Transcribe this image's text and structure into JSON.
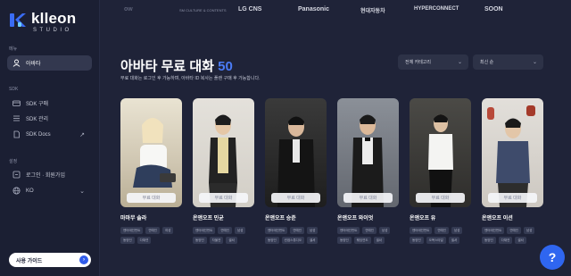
{
  "brand": {
    "name": "klleon",
    "sub": "STUDIO"
  },
  "sidebar": {
    "section_main": "메뉴",
    "section_sdk": "SDK",
    "section_settings": "설정",
    "items": [
      {
        "label": "아바타",
        "icon": "avatar-icon"
      },
      {
        "label": "SDK 구매",
        "icon": "card-icon"
      },
      {
        "label": "SDK 관리",
        "icon": "manage-icon"
      },
      {
        "label": "SDK Docs",
        "icon": "docs-icon",
        "right": "↗"
      },
      {
        "label": "로그인 · 회원가입",
        "icon": "login-icon",
        "right": "•"
      },
      {
        "label": "KO",
        "icon": "globe-icon",
        "right": "⌄"
      }
    ],
    "guide_label": "사용 가이드",
    "guide_arrow": "›"
  },
  "partners": [
    "ow",
    "SM CULTURE & CONTENTS",
    "LG CNS",
    "Panasonic",
    "현대자동차",
    "HYPERCONNECT",
    "SOON"
  ],
  "main": {
    "title": "아바타 무료 대화",
    "count": "50",
    "subtitle": "무료 대화는 로그인 후 가능하며, 아바타 ID 복사는 플랜 구매 후 가능합니다.",
    "filter_category": "전체 카테고리",
    "filter_sort": "최신 순"
  },
  "card_button_label": "무료 대화",
  "cards": [
    {
      "name": "마마무 솔라",
      "tags": [
        "엔터테인먼트",
        "연예인",
        "여성",
        "동양인",
        "다채연"
      ],
      "bg": "#cfc6b1"
    },
    {
      "name": "온앤오프 민균",
      "tags": [
        "엔터테인먼트",
        "연예인",
        "남성",
        "동양인",
        "자율연",
        "셀셔"
      ],
      "bg": "#d8d4cc"
    },
    {
      "name": "온앤오프 승준",
      "tags": [
        "엔터테인먼트",
        "연예인",
        "남성",
        "동양인",
        "컨셉스튜디오",
        "셀셔"
      ],
      "bg": "#2a2a2a"
    },
    {
      "name": "온앤오프 와이엇",
      "tags": [
        "엔터테인먼트",
        "연예인",
        "남성",
        "동양인",
        "웨딩연도",
        "셀셔"
      ],
      "bg": "#7a7f88"
    },
    {
      "name": "온앤오프 유",
      "tags": [
        "엔터테인먼트",
        "연예인",
        "남성",
        "동양인",
        "오목스타일",
        "셀셔"
      ],
      "bg": "#3e3e3c"
    },
    {
      "name": "온앤오프 이션",
      "tags": [
        "엔터테인먼트",
        "연예인",
        "남성",
        "동양인",
        "다채연",
        "셀셔"
      ],
      "bg": "#d9d6d1"
    }
  ],
  "help_label": "?"
}
